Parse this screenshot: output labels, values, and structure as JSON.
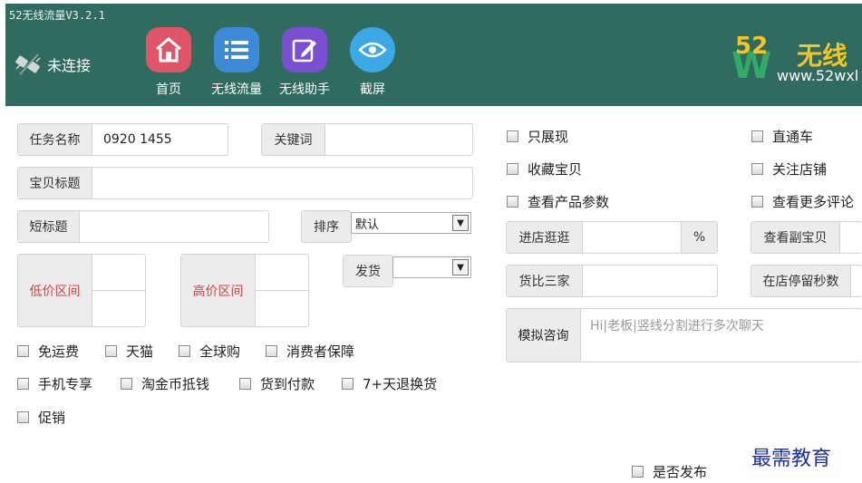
{
  "window": {
    "title": "52无线流量V3.2.1"
  },
  "connection": {
    "status": "未连接"
  },
  "nav": [
    {
      "label": "首页",
      "icon": "home-icon"
    },
    {
      "label": "无线流量",
      "icon": "list-icon"
    },
    {
      "label": "无线助手",
      "icon": "edit-icon"
    },
    {
      "label": "截屏",
      "icon": "eye-icon"
    }
  ],
  "logo": {
    "num": "52",
    "cn": "无线",
    "url": "www.52wxl"
  },
  "form": {
    "task_name_label": "任务名称",
    "task_name_value": "0920 1455",
    "keyword_label": "关键词",
    "keyword_value": "",
    "item_title_label": "宝贝标题",
    "item_title_value": "",
    "short_title_label": "短标题",
    "short_title_value": "",
    "sort_label": "排序",
    "sort_value": "默认",
    "ship_label": "发货",
    "ship_value": "",
    "low_price_label": "低价区间",
    "high_price_label": "高价区间"
  },
  "left_checkboxes_row1": [
    "免运费",
    "天猫",
    "全球购",
    "消费者保障"
  ],
  "left_checkboxes_row2": [
    "手机专享",
    "淘金币抵钱",
    "货到付款",
    "7+天退换货"
  ],
  "left_checkboxes_row3": [
    "促销"
  ],
  "right_checkboxes": {
    "impression_only": "只展现",
    "express_train": "直通车",
    "favorite_item": "收藏宝贝",
    "follow_store": "关注店铺",
    "view_params": "查看产品参数",
    "view_more_reviews": "查看更多评论"
  },
  "right_fields": {
    "browse_label": "进店逛逛",
    "browse_unit": "%",
    "view_sub_item_label": "查看副宝贝",
    "compare_label": "货比三家",
    "stay_seconds_label": "在店停留秒数",
    "consult_label": "模拟咨询",
    "consult_placeholder": "Hi|老板|竖线分割进行多次聊天"
  },
  "publish": {
    "label": "是否发布"
  },
  "watermark": "最需教育"
}
